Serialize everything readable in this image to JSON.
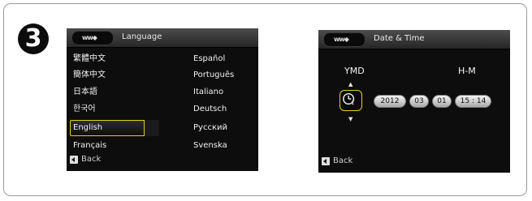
{
  "step_number": "3",
  "language_screen": {
    "title": "Language",
    "title_icon": "menu-tab-icon",
    "items_left": [
      "繁體中文",
      "簡体中文",
      "日本語",
      "한국어",
      "English",
      "Français"
    ],
    "items_right": [
      "Español",
      "Português",
      "Italiano",
      "Deutsch",
      "Русский",
      "Svenska"
    ],
    "selected": "English",
    "back_label": "Back"
  },
  "datetime_screen": {
    "title": "Date & Time",
    "title_icon": "menu-tab-icon",
    "date_format": "YMD",
    "time_format": "H-M",
    "year": "2012",
    "month": "03",
    "day": "01",
    "time": "15 : 14",
    "back_label": "Back"
  },
  "colors": {
    "highlight": "#e4d020",
    "screen_bg": "#0d0d0d"
  }
}
